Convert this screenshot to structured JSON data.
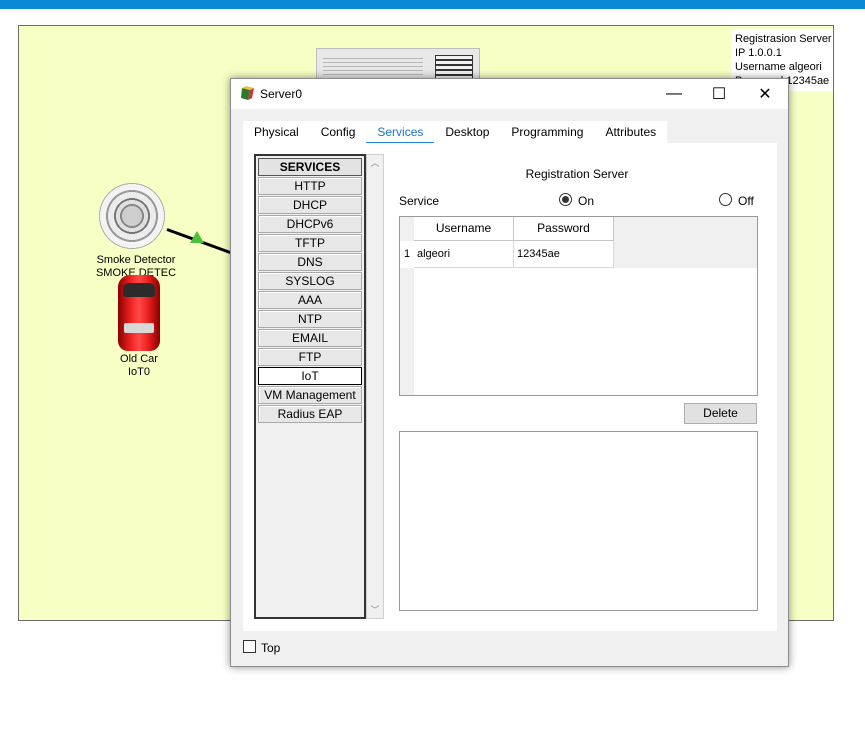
{
  "workspace": {
    "info": {
      "line1": "Registrasion Server",
      "line2": "IP 1.0.0.1",
      "line3": "Username algeori",
      "line4": "Password 12345ae"
    },
    "devices": [
      {
        "name": "Smoke Detector",
        "id": "SMOKE DETEC"
      },
      {
        "name": "Old Car",
        "id": "IoT0"
      }
    ]
  },
  "dialog": {
    "title": "Server0",
    "controls": {
      "minimize": "—",
      "maximize": "☐",
      "close": "✕"
    },
    "tabs": [
      "Physical",
      "Config",
      "Services",
      "Desktop",
      "Programming",
      "Attributes"
    ],
    "active_tab": "Services",
    "services": {
      "header": "SERVICES",
      "items": [
        "HTTP",
        "DHCP",
        "DHCPv6",
        "TFTP",
        "DNS",
        "SYSLOG",
        "AAA",
        "NTP",
        "EMAIL",
        "FTP",
        "IoT",
        "VM Management",
        "Radius EAP"
      ],
      "active": "IoT"
    },
    "registration": {
      "title": "Registration Server",
      "service_label": "Service",
      "on_label": "On",
      "off_label": "Off",
      "state": "On",
      "table": {
        "headers": [
          "Username",
          "Password"
        ],
        "rows": [
          {
            "num": "1",
            "username": "algeori",
            "password": "12345ae"
          }
        ]
      },
      "delete_label": "Delete"
    },
    "top_label": "Top"
  },
  "colors": {
    "accent": "#1e88d4",
    "workspace_bg": "#f7ffc4",
    "topbar": "#0a8ad6"
  }
}
